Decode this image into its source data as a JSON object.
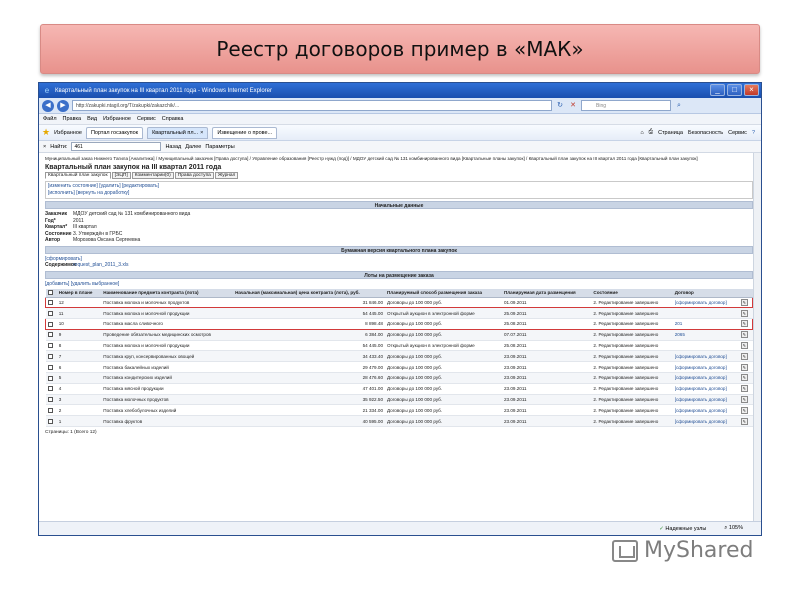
{
  "slide": {
    "title": "Реестр договоров пример в «МАК»"
  },
  "window": {
    "title": "Квартальный план закупок на III квартал 2011 года - Windows Internet Explorer",
    "url": "http://zakupki.ntagil.org/T/zakupki/zakazchik/...",
    "search_placeholder": "Bing",
    "menu": [
      "Файл",
      "Правка",
      "Вид",
      "Избранное",
      "Сервис",
      "Справка"
    ],
    "fav_label": "Избранное",
    "tabs": [
      "Портал госзакупок",
      "Квартальный пл...",
      "Извещение о прове..."
    ],
    "fav_right": [
      "Страница",
      "Безопасность",
      "Сервис"
    ],
    "find_label": "Найти:",
    "find_value": "461",
    "find_back": "Назад",
    "find_next": "Далее",
    "find_params": "Параметры"
  },
  "page": {
    "breadcrumbs": "Муниципальный заказ Нижнего Тагила [Аналитика] / Муниципальный заказчик [Права доступа] / Управление образования [Реестр нужд (под)] / МДОУ детский сад № 131 комбинированного вида [Квартальные планы закупок] / Квартальный план закупок на III квартал 2011 года [Квартальный план закупок]",
    "heading": "Квартальный план закупок на III квартал 2011 года",
    "tabs": [
      "Квартальный план закупок",
      "[ЭЦП]",
      "Комментарии(0)",
      "Права доступа",
      "Журнал"
    ],
    "actions1": "[изменить состояние] [удалить] [редактировать]",
    "actions2": "[исполнить] [вернуть на доработку]",
    "section_basic": "Начальные данные",
    "basic": [
      {
        "k": "Заказчик",
        "v": "МДОУ детский сад № 131 комбинированного вида"
      },
      {
        "k": "Год*",
        "v": "2011"
      },
      {
        "k": "Квартал*",
        "v": "III квартал"
      },
      {
        "k": "Состояние",
        "v": "3. Утверждён в ГРБС"
      },
      {
        "k": "Автор",
        "v": "Морозова Оксана Сергеевна"
      }
    ],
    "section_paper": "Бумажная версия квартального плана закупок",
    "paper_action": "[сформировать]",
    "paper_content_label": "Содержимое",
    "paper_content_value": "request_plan_2011_3.xls",
    "section_lots": "Лоты на размещение заказа",
    "lots_actions": "[добавить] [удалить выбранное]",
    "columns": [
      "Номер в плане",
      "Наименование предмета контракта (лота)",
      "Начальная (максимальная) цена контракта (лота), руб.",
      "Планируемый способ размещения заказа",
      "Планируемая дата размещения",
      "Состояние",
      "Договор"
    ],
    "rows": [
      {
        "num": "12",
        "name": "Поставка молока и молочных продуктов",
        "price": "31 846.00",
        "method": "Договоры до 100 000 руб.",
        "date": "01.09.2011",
        "state": "2. Редактирование завершено",
        "contract": "[сформировать договор]",
        "hl": true
      },
      {
        "num": "11",
        "name": "Поставка молока и молочной продукции",
        "price": "54 445.00",
        "method": "Открытый аукцион в электронной форме",
        "date": "25.09.2011",
        "state": "2. Редактирование завершено",
        "contract": "",
        "hl": false
      },
      {
        "num": "10",
        "name": "Поставка масла сливочного",
        "price": "8 898.48",
        "method": "Договоры до 100 000 руб.",
        "date": "25.08.2011",
        "state": "2. Редактирование завершено",
        "contract": "201",
        "hl": true
      },
      {
        "num": "9",
        "name": "Проведение обязательных медицинских осмотров",
        "price": "6 384.00",
        "method": "Договоры до 100 000 руб.",
        "date": "07.07.2011",
        "state": "2. Редактирование завершено",
        "contract": "2065",
        "hl": false
      },
      {
        "num": "8",
        "name": "Поставка молока и молочной продукции",
        "price": "54 445.00",
        "method": "Открытый аукцион в электронной форме",
        "date": "25.08.2011",
        "state": "2. Редактирование завершено",
        "contract": "",
        "hl": false
      },
      {
        "num": "7",
        "name": "Поставка круп, консервированных овощей",
        "price": "34 433.40",
        "method": "Договоры до 100 000 руб.",
        "date": "23.09.2011",
        "state": "2. Редактирование завершено",
        "contract": "[сформировать договор]",
        "hl": false
      },
      {
        "num": "6",
        "name": "Поставка бакалейных изделий",
        "price": "29 479.00",
        "method": "Договоры до 100 000 руб.",
        "date": "23.09.2011",
        "state": "2. Редактирование завершено",
        "contract": "[сформировать договор]",
        "hl": false
      },
      {
        "num": "5",
        "name": "Поставка кондитерских изделий",
        "price": "28 476.60",
        "method": "Договоры до 100 000 руб.",
        "date": "23.09.2011",
        "state": "2. Редактирование завершено",
        "contract": "[сформировать договор]",
        "hl": false
      },
      {
        "num": "4",
        "name": "Поставка мясной продукции",
        "price": "47 401.00",
        "method": "Договоры до 100 000 руб.",
        "date": "23.09.2011",
        "state": "2. Редактирование завершено",
        "contract": "[сформировать договор]",
        "hl": false
      },
      {
        "num": "3",
        "name": "Поставка молочных продуктов",
        "price": "35 922.50",
        "method": "Договоры до 100 000 руб.",
        "date": "23.09.2011",
        "state": "2. Редактирование завершено",
        "contract": "[сформировать договор]",
        "hl": false
      },
      {
        "num": "2",
        "name": "Поставка хлебобулочных изделий",
        "price": "21 334.00",
        "method": "Договоры до 100 000 руб.",
        "date": "23.09.2011",
        "state": "2. Редактирование завершено",
        "contract": "[сформировать договор]",
        "hl": false
      },
      {
        "num": "1",
        "name": "Поставка фруктов",
        "price": "40 595.00",
        "method": "Договоры до 100 000 руб.",
        "date": "23.09.2011",
        "state": "2. Редактирование завершено",
        "contract": "[сформировать договор]",
        "hl": false
      }
    ],
    "pages": "Страницы: 1 (Всего 12)"
  },
  "status": {
    "zone": "Надежные узлы",
    "zoom": "105%"
  },
  "watermark": "MyShared",
  "colors": {
    "highlight": "#d23a3a",
    "link": "#224f95",
    "titlebar": "#2f6fd6"
  }
}
